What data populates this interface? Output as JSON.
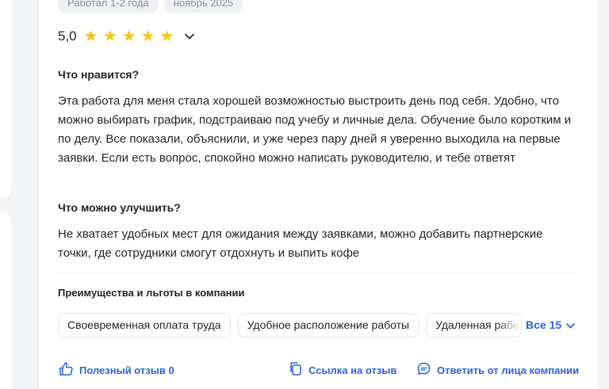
{
  "tags": [
    "Работал 1-2 года",
    "ноябрь 2025"
  ],
  "rating": {
    "value": "5,0",
    "stars": 5
  },
  "likes": {
    "title": "Что нравится?",
    "text": "Эта работа для меня стала хорошей возможностью выстроить день под себя. Удобно, что можно выбирать график, подстраиваю под учебу и личные дела. Обучение было коротким и по делу. Все показали, объяснили, и уже через пару дней я уверенно выходила на первые заявки. Если есть вопрос, спокойно можно написать руководителю, и тебе ответят"
  },
  "improve": {
    "title": "Что можно улучшить?",
    "text": "Не хватает удобных мест для ожидания между заявками, можно добавить партнерские точки, где сотрудники смогут отдохнуть и выпить кофе"
  },
  "benefits": {
    "title": "Преимущества и льготы в компании",
    "items": [
      "Своевременная оплата труда",
      "Удобное расположение работы",
      "Удаленная работа"
    ],
    "all_label": "Все 15"
  },
  "actions": {
    "helpful": "Полезный отзыв 0",
    "link": "Ссылка на отзыв",
    "reply": "Ответить от лица компании"
  },
  "colors": {
    "accent": "#2b63d9",
    "star": "#f5c518",
    "text": "#1f2329",
    "tag_bg": "#eef0f3"
  },
  "icons": [
    "star-icon",
    "chevron-down-icon",
    "thumbs-up-icon",
    "copy-link-icon",
    "chat-bubble-icon"
  ]
}
